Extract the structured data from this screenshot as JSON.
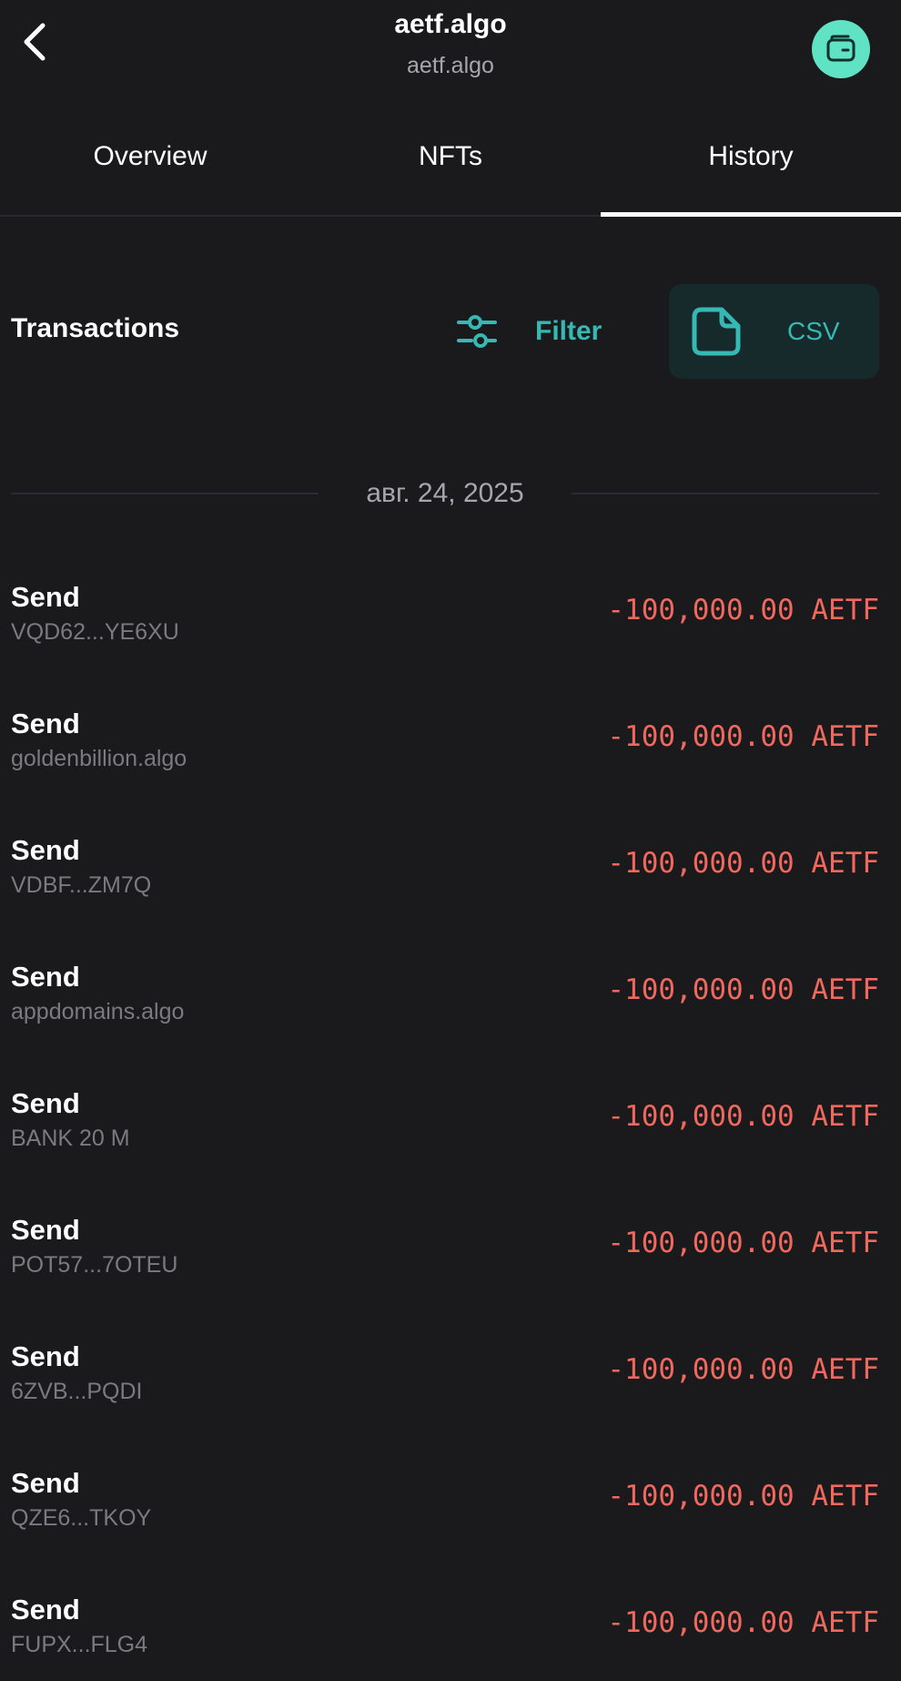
{
  "header": {
    "title": "aetf.algo",
    "subtitle": "aetf.algo"
  },
  "tabs": [
    {
      "label": "Overview",
      "active": false
    },
    {
      "label": "NFTs",
      "active": false
    },
    {
      "label": "History",
      "active": true
    }
  ],
  "transactions_header": {
    "title": "Transactions",
    "filter_label": "Filter",
    "csv_label": "CSV"
  },
  "date_group": "авг. 24, 2025",
  "transactions": [
    {
      "type": "Send",
      "party": "VQD62...YE6XU",
      "amount": "-100,000.00 AETF"
    },
    {
      "type": "Send",
      "party": "goldenbillion.algo",
      "amount": "-100,000.00 AETF"
    },
    {
      "type": "Send",
      "party": "VDBF...ZM7Q",
      "amount": "-100,000.00 AETF"
    },
    {
      "type": "Send",
      "party": "appdomains.algo",
      "amount": "-100,000.00 AETF"
    },
    {
      "type": "Send",
      "party": "BANK 20 M",
      "amount": "-100,000.00 AETF"
    },
    {
      "type": "Send",
      "party": "POT57...7OTEU",
      "amount": "-100,000.00 AETF"
    },
    {
      "type": "Send",
      "party": "6ZVB...PQDI",
      "amount": "-100,000.00 AETF"
    },
    {
      "type": "Send",
      "party": "QZE6...TKOY",
      "amount": "-100,000.00 AETF"
    },
    {
      "type": "Send",
      "party": "FUPX...FLG4",
      "amount": "-100,000.00 AETF"
    }
  ],
  "icons": {
    "back": "chevron-left-icon",
    "wallet": "wallet-icon",
    "filter": "sliders-icon",
    "csv": "document-icon"
  },
  "colors": {
    "background": "#1a1a1c",
    "accent": "#36b8b3",
    "wallet_button": "#5fe3c4",
    "negative_amount": "#f0685e"
  }
}
